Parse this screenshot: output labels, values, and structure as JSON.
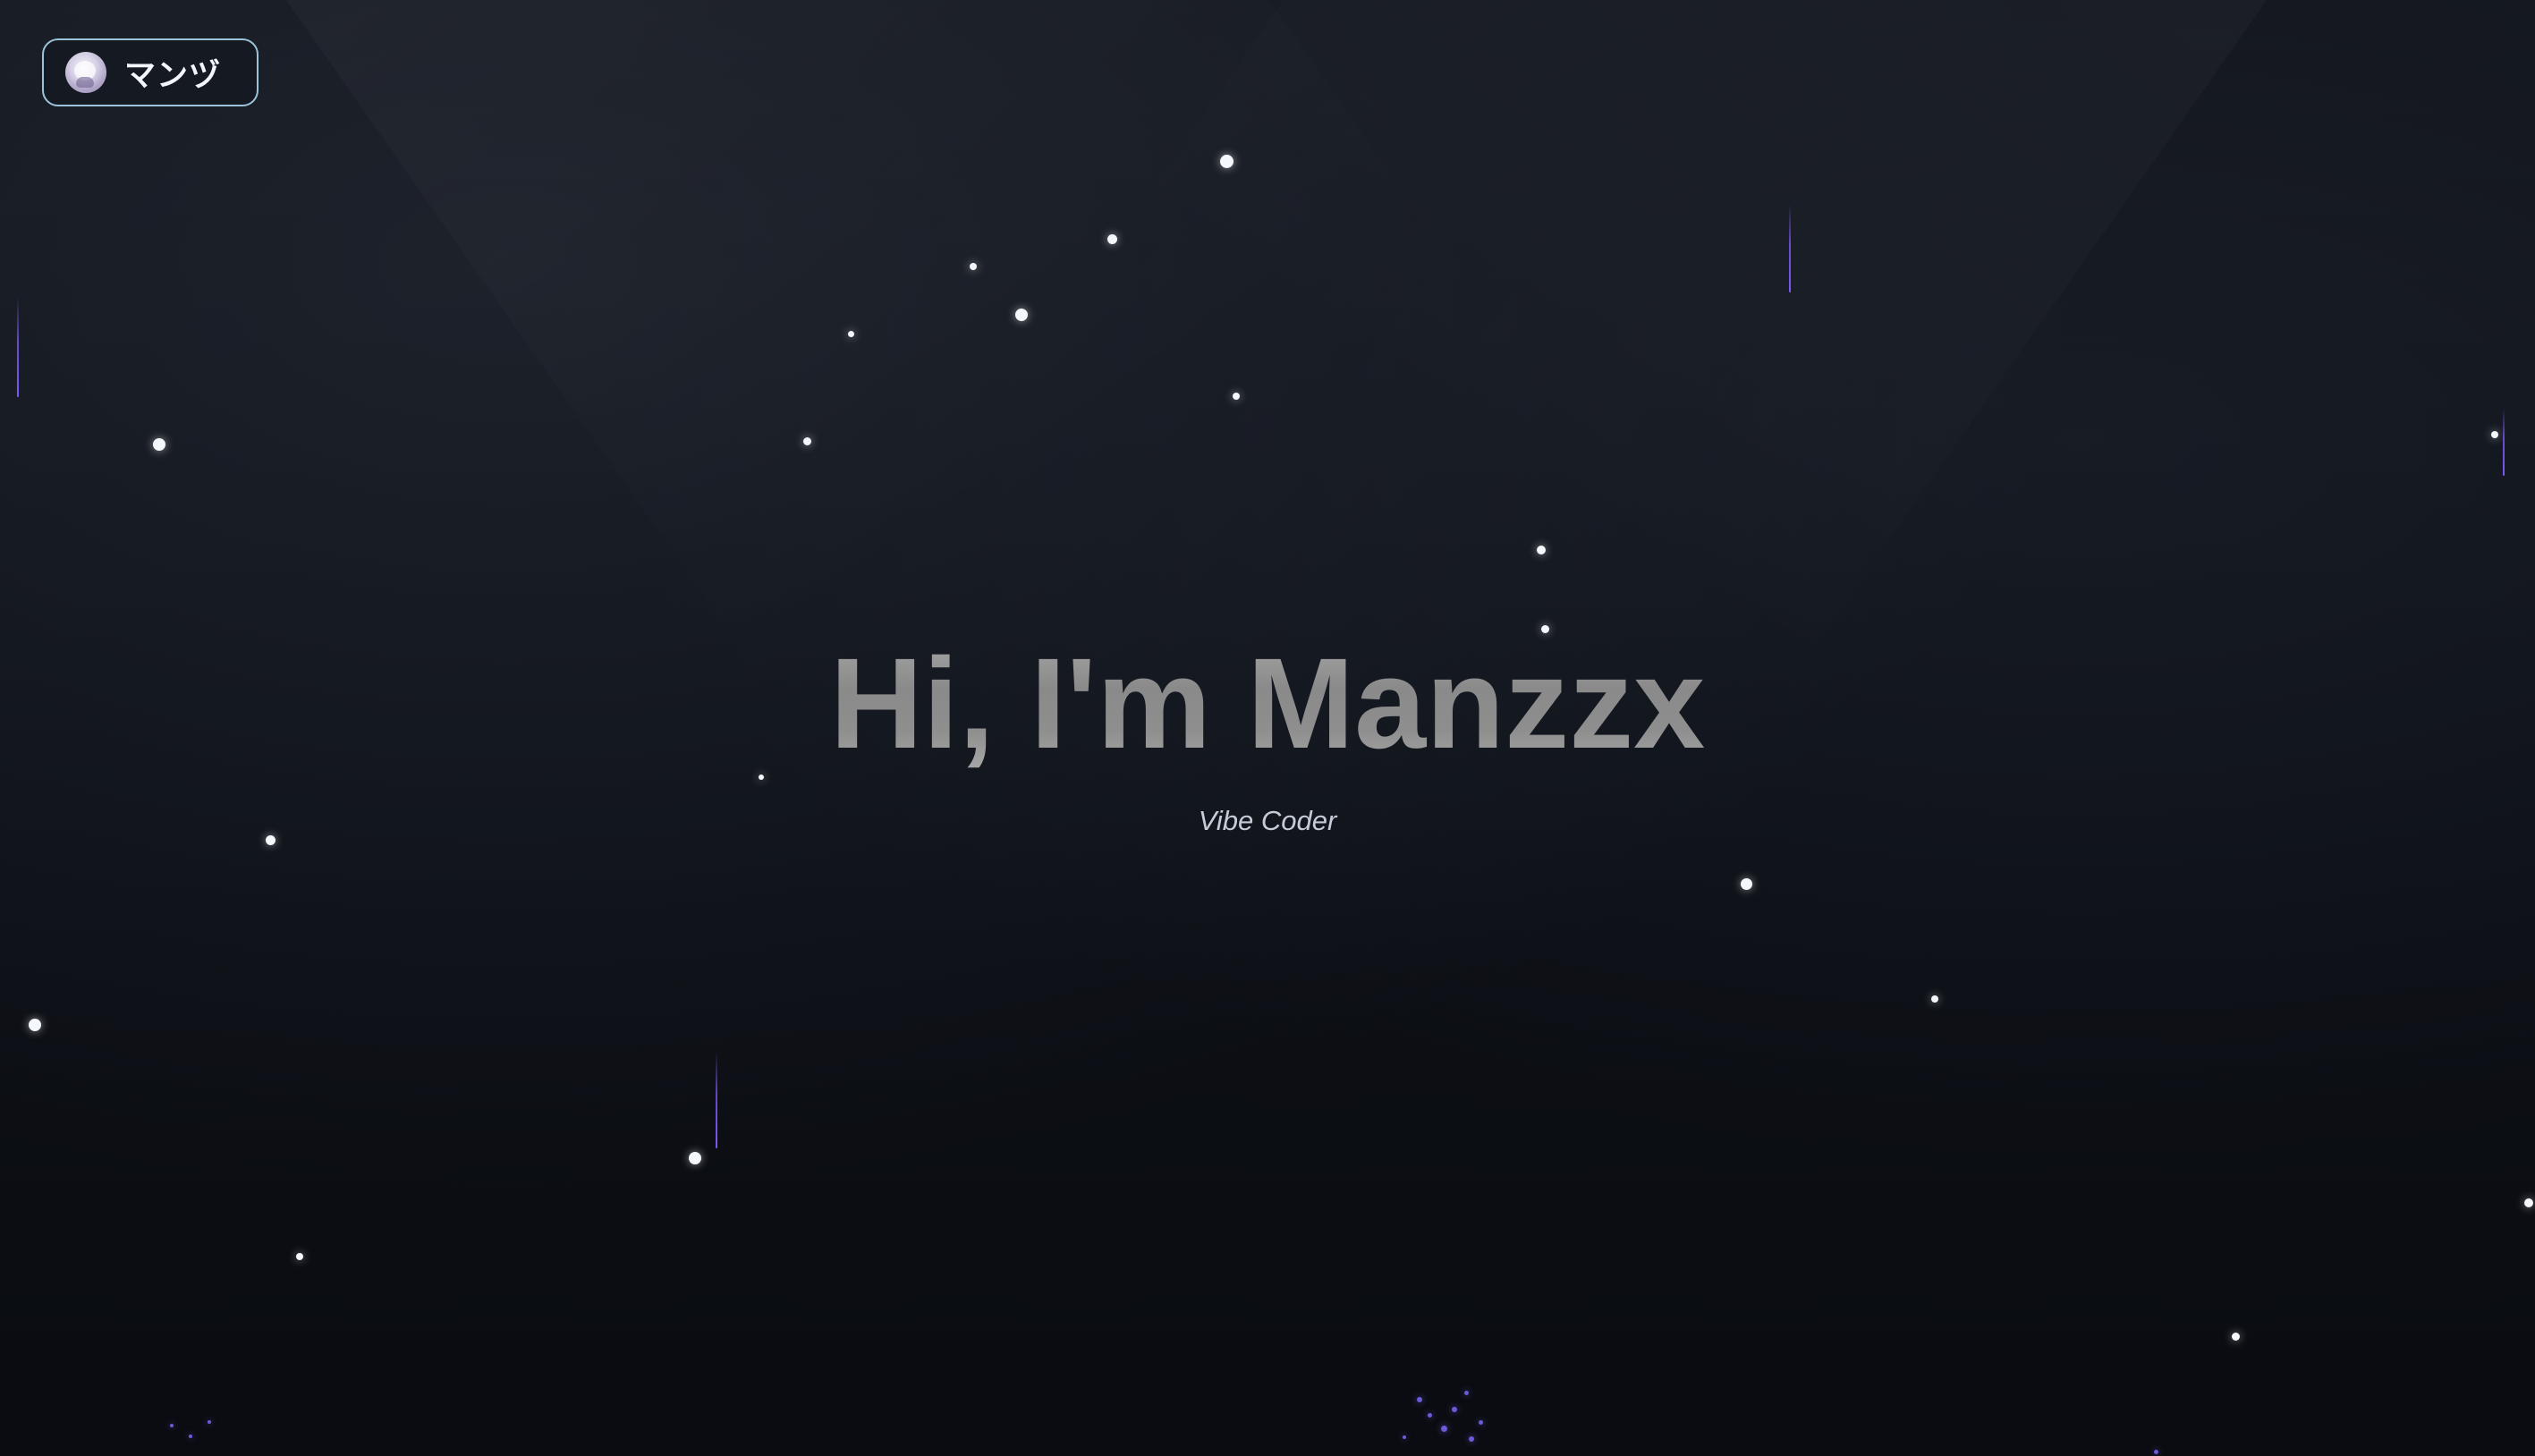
{
  "header": {
    "brand_name": "マンヅ"
  },
  "hero": {
    "title": "Hi, I'm Manzzx",
    "subtitle": "Vibe Coder"
  },
  "colors": {
    "background": "#0b0d12",
    "accent": "#8a5cff",
    "pill_border": "#9cc3da",
    "title_gradient_start": "#a4a4a4",
    "title_gradient_end": "#8a8a8a",
    "subtitle": "#c5ccd8"
  },
  "icons": {
    "avatar": "profile-avatar-icon"
  }
}
